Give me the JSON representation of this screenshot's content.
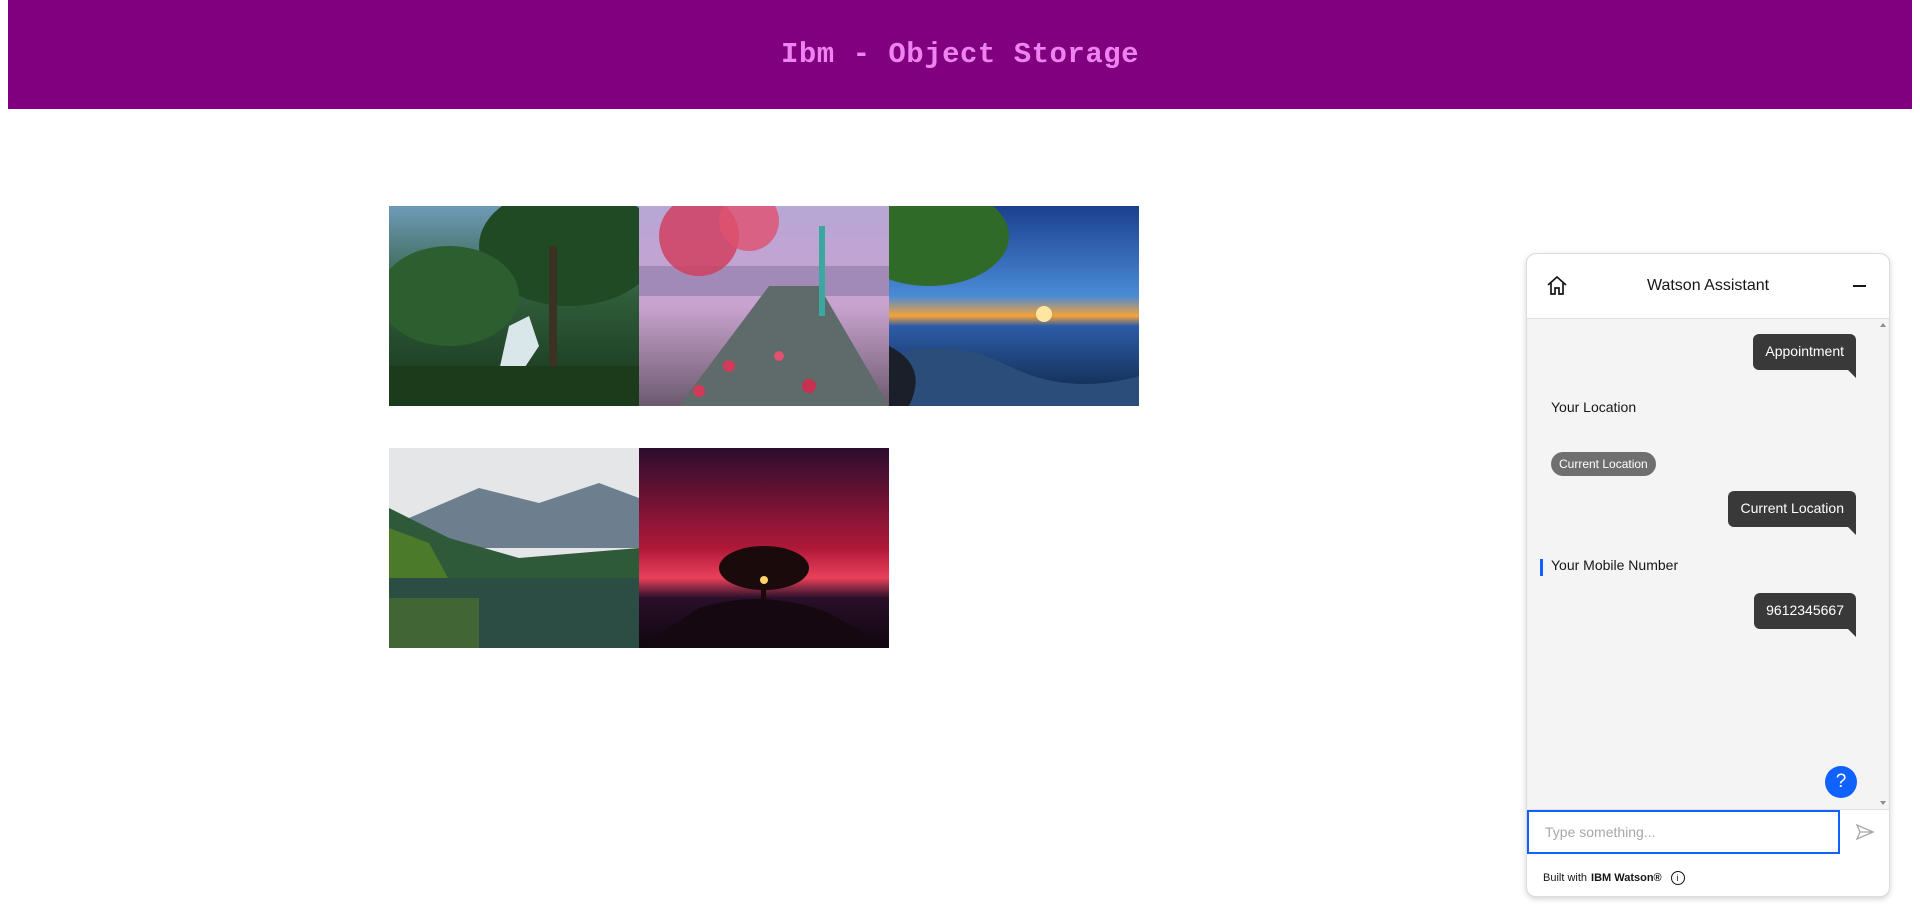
{
  "header": {
    "title": "Ibm - Object Storage"
  },
  "gallery": [
    {
      "name": "forest-waterfall-image"
    },
    {
      "name": "pink-leaves-dock-image"
    },
    {
      "name": "lake-sunset-image"
    },
    {
      "name": "mountain-lake-image"
    },
    {
      "name": "red-sky-tree-image"
    }
  ],
  "assistant": {
    "title": "Watson Assistant",
    "messages": {
      "user1": "Appointment",
      "bot1": "Your Location",
      "chip1": "Current Location",
      "user2": "Current Location",
      "bot2": "Your Mobile Number",
      "user3": "9612345667"
    },
    "help_label": "?",
    "input_placeholder": "Type something...",
    "footer_prefix": "Built with",
    "footer_brand": "IBM Watson®",
    "info_label": "i"
  },
  "colors": {
    "header_bg": "#800080",
    "header_text": "#ee82ee",
    "accent": "#0f62fe",
    "user_bubble": "#393939"
  },
  "icons": [
    "home-icon",
    "minimize-icon",
    "send-icon",
    "help-icon",
    "info-icon"
  ]
}
